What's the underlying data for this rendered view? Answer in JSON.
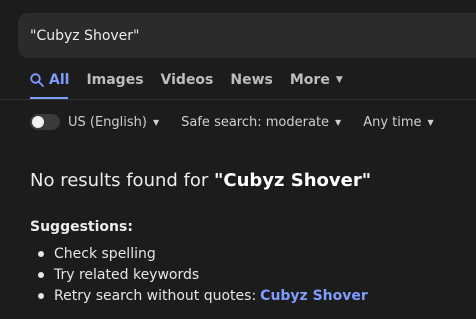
{
  "search": {
    "value": "\"Cubyz Shover\""
  },
  "tabs": [
    {
      "label": "All",
      "icon": "search-icon",
      "active": true
    },
    {
      "label": "Images"
    },
    {
      "label": "Videos"
    },
    {
      "label": "News"
    },
    {
      "label": "More",
      "icon": "caret-down-icon"
    }
  ],
  "filters": {
    "region": "US (English)",
    "safe_search": "Safe search: moderate",
    "time": "Any time"
  },
  "results": {
    "prefix": "No results found for ",
    "query": "\"Cubyz Shover\""
  },
  "suggestions": {
    "title": "Suggestions:",
    "items": [
      "Check spelling",
      "Try related keywords",
      "Retry search without quotes:"
    ],
    "link": "Cubyz Shover"
  },
  "colors": {
    "accent": "#7f9cff",
    "background": "#1c1c1c"
  }
}
